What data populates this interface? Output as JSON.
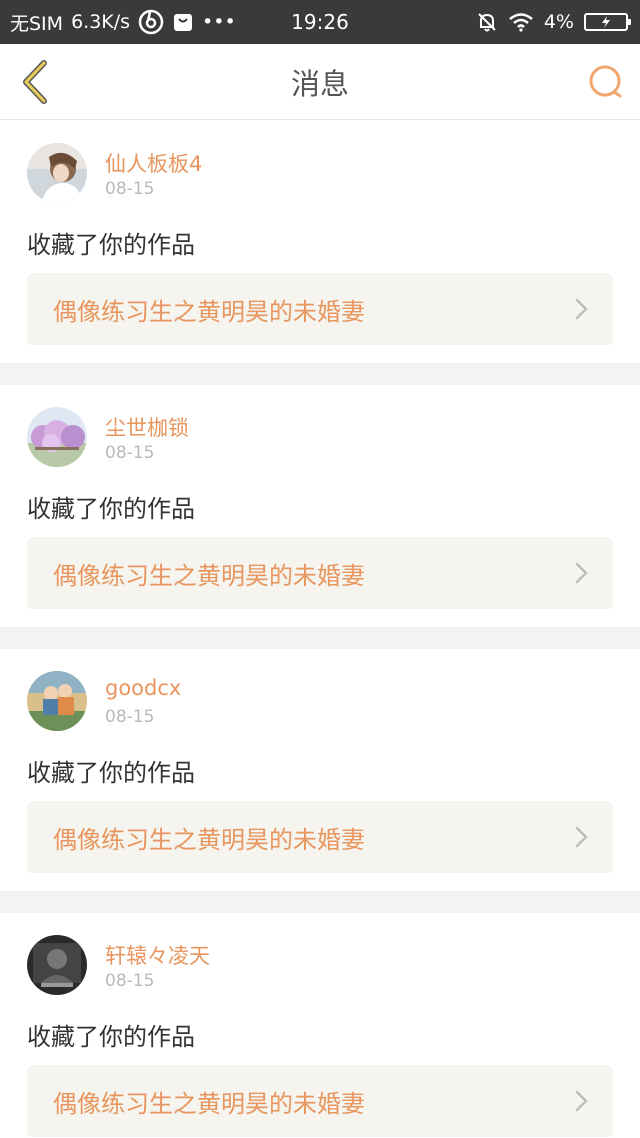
{
  "status_bar": {
    "carrier": "无SIM",
    "speed": "6.3K/s",
    "more": "•••",
    "time": "19:26",
    "battery": "4%"
  },
  "header": {
    "title": "消息"
  },
  "colors": {
    "accent": "#e8955e",
    "back_icon": "#c9a93a",
    "card_bg": "#f5f4ee",
    "separator": "#f3f3f3"
  },
  "messages": [
    {
      "user": "仙人板板4",
      "date": "08-15",
      "action": "收藏了你的作品",
      "work_title": "偶像练习生之黄明昊的未婚妻"
    },
    {
      "user": "尘世枷锁",
      "date": "08-15",
      "action": "收藏了你的作品",
      "work_title": "偶像练习生之黄明昊的未婚妻"
    },
    {
      "user": "goodcx",
      "date": "08-15",
      "action": "收藏了你的作品",
      "work_title": "偶像练习生之黄明昊的未婚妻"
    },
    {
      "user": "轩辕々凌天",
      "date": "08-15",
      "action": "收藏了你的作品",
      "work_title": "偶像练习生之黄明昊的未婚妻"
    }
  ]
}
